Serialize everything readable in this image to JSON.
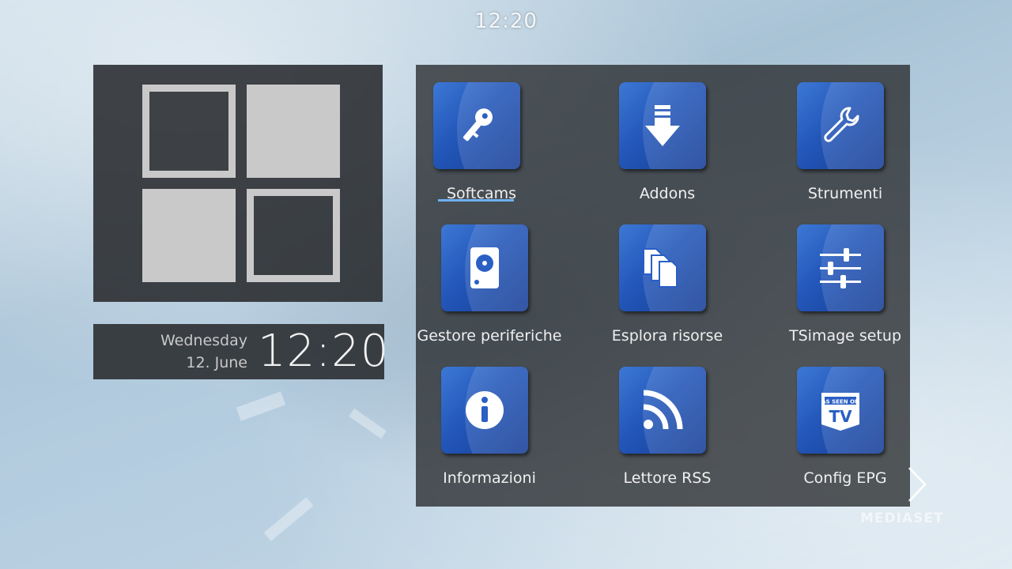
{
  "status_bar": {
    "clock": "12:20"
  },
  "clock_widget": {
    "weekday": "Wednesday",
    "date": "12. June",
    "time": "12:20"
  },
  "menu": {
    "items": [
      {
        "label": "Softcams",
        "icon": "key-icon",
        "focused": true
      },
      {
        "label": "Addons",
        "icon": "download-icon",
        "focused": false
      },
      {
        "label": "Strumenti",
        "icon": "wrench-icon",
        "focused": false
      },
      {
        "label": "Gestore periferiche",
        "icon": "harddisk-icon",
        "focused": false
      },
      {
        "label": "Esplora risorse",
        "icon": "files-icon",
        "focused": false
      },
      {
        "label": "TSimage setup",
        "icon": "sliders-icon",
        "focused": false
      },
      {
        "label": "Informazioni",
        "icon": "info-icon",
        "focused": false
      },
      {
        "label": "Lettore RSS",
        "icon": "rss-icon",
        "focused": false
      },
      {
        "label": "Config EPG",
        "icon": "tv-icon",
        "focused": false
      }
    ]
  },
  "channel_logo": {
    "text": "MEDIASET"
  },
  "colors": {
    "icon_blue": "#2a5fc4",
    "panel": "#2a2c2f",
    "focus": "#6fb0f0"
  }
}
